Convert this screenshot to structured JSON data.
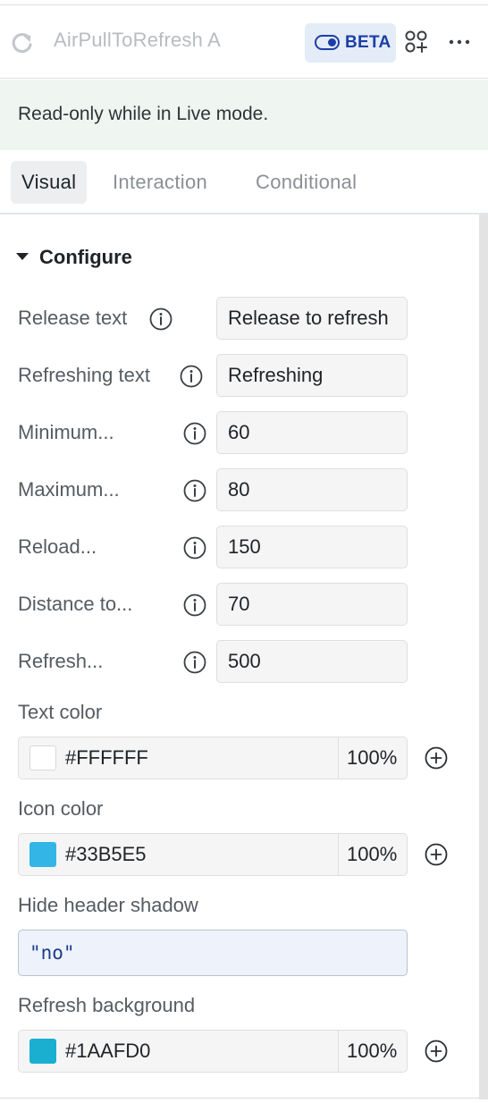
{
  "header": {
    "title": "AirPullToRefresh A",
    "beta_label": "BETA"
  },
  "notice": {
    "text": "Read-only while in Live mode."
  },
  "tabs": [
    {
      "label": "Visual",
      "active": true
    },
    {
      "label": "Interaction",
      "active": false
    },
    {
      "label": "Conditional",
      "active": false
    }
  ],
  "section": {
    "title": "Configure"
  },
  "rows": [
    {
      "label": "Release text",
      "value": "Release to refresh"
    },
    {
      "label": "Refreshing text",
      "value": "Refreshing"
    },
    {
      "label": "Minimum...",
      "value": "60"
    },
    {
      "label": "Maximum...",
      "value": "80"
    },
    {
      "label": "Reload...",
      "value": "150"
    },
    {
      "label": "Distance to...",
      "value": "70"
    },
    {
      "label": "Refresh...",
      "value": "500"
    }
  ],
  "text_color": {
    "label": "Text color",
    "hex": "#FFFFFF",
    "opacity": "100%",
    "swatch": "#FFFFFF"
  },
  "icon_color": {
    "label": "Icon color",
    "hex": "#33B5E5",
    "opacity": "100%",
    "swatch": "#33B5E5"
  },
  "hide_header_shadow": {
    "label": "Hide header shadow",
    "value": "\"no\""
  },
  "refresh_background": {
    "label": "Refresh background",
    "hex": "#1AAFD0",
    "opacity": "100%",
    "swatch": "#1AAFD0"
  },
  "colors": {
    "accent": "#1C3FA6",
    "beta_bg": "#E4ECF7",
    "notice_bg": "#EFF6F1"
  }
}
